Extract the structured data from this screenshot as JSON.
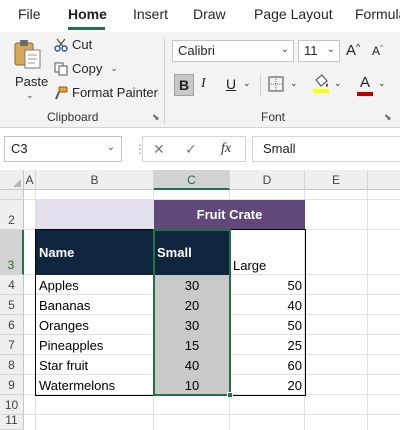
{
  "menu": {
    "tabs": [
      "File",
      "Home",
      "Insert",
      "Draw",
      "Page Layout",
      "Formula"
    ],
    "active_tab": "Home",
    "accent": "#217346"
  },
  "ribbon": {
    "clipboard": {
      "paste": "Paste",
      "cut": "Cut",
      "copy": "Copy",
      "format_painter": "Format Painter",
      "group_label": "Clipboard"
    },
    "font": {
      "font_name": "Calibri",
      "font_size": "11",
      "bold": "B",
      "italic": "I",
      "underline": "U",
      "font_color_glyph": "A",
      "grow_font": "A",
      "shrink_font": "A",
      "group_label": "Font"
    }
  },
  "formula_bar": {
    "name_box": "C3",
    "cancel_glyph": "✕",
    "enter_glyph": "✓",
    "fx_glyph": "fx",
    "formula": "Small"
  },
  "sheet": {
    "columns": [
      "A",
      "B",
      "C",
      "D",
      "E"
    ],
    "selected_column": "C",
    "rows": [
      "1",
      "2",
      "3",
      "4",
      "5",
      "6",
      "7",
      "8",
      "9",
      "10",
      "11"
    ],
    "header_title": "Fruit Crate",
    "col_headers": {
      "name": "Name",
      "small": "Small",
      "large": "Large"
    },
    "data": [
      {
        "name": "Apples",
        "small": "30",
        "large": "50"
      },
      {
        "name": "Bananas",
        "small": "20",
        "large": "40"
      },
      {
        "name": "Oranges",
        "small": "30",
        "large": "50"
      },
      {
        "name": "Pineapples",
        "small": "15",
        "large": "25"
      },
      {
        "name": "Star fruit",
        "small": "40",
        "large": "60"
      },
      {
        "name": "Watermelons",
        "small": "10",
        "large": "20"
      }
    ],
    "colors": {
      "lavender": "#e4dfec",
      "purple": "#60497a",
      "navy": "#0f243e",
      "selection_gray": "#c9c9c9",
      "selection_border": "#217346"
    }
  }
}
